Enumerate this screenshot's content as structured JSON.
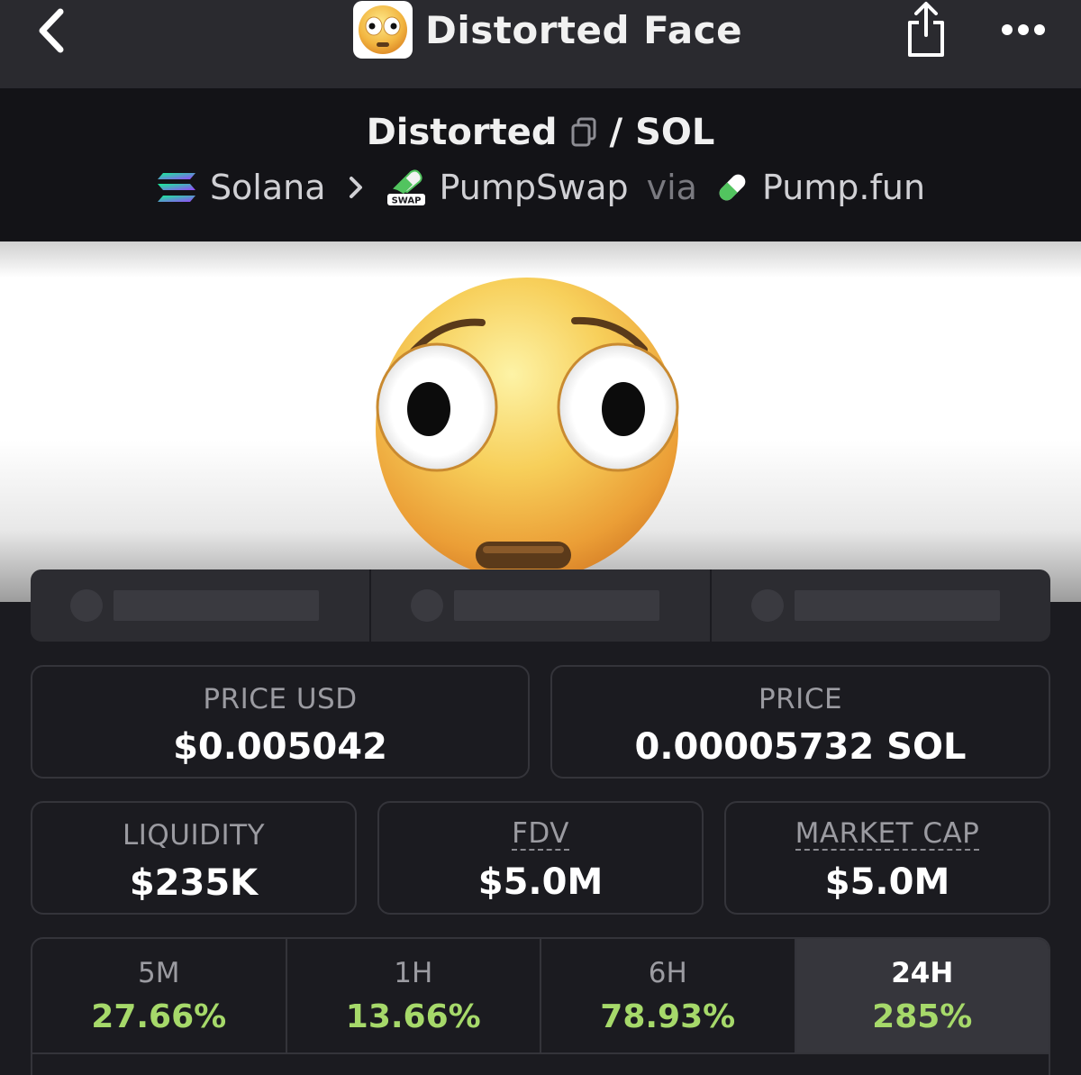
{
  "nav": {
    "title": "Distorted Face",
    "back_icon": "chevron-left-icon",
    "share_icon": "share-icon",
    "more_icon": "more-dots-icon"
  },
  "pair": {
    "base": "Distorted",
    "separator": "/",
    "quote": "SOL",
    "chain": "Solana",
    "dex": "PumpSwap",
    "via": "via",
    "launchpad": "Pump.fun",
    "dex_badge": "SWAP"
  },
  "stats": {
    "price_usd": {
      "label": "PRICE USD",
      "value": "$0.005042"
    },
    "price_native": {
      "label": "PRICE",
      "value": "0.00005732 SOL"
    },
    "liquidity": {
      "label": "LIQUIDITY",
      "value": "$235K"
    },
    "fdv": {
      "label": "FDV",
      "value": "$5.0M"
    },
    "market_cap": {
      "label": "MARKET CAP",
      "value": "$5.0M"
    }
  },
  "changes": [
    {
      "label": "5M",
      "value": "27.66%",
      "active": false
    },
    {
      "label": "1H",
      "value": "13.66%",
      "active": false
    },
    {
      "label": "6H",
      "value": "78.93%",
      "active": false
    },
    {
      "label": "24H",
      "value": "285%",
      "active": true
    }
  ],
  "colors": {
    "positive": "#a6d96a",
    "background": "#1b1b20",
    "nav_bg": "#2a2a2f",
    "header_bg": "#131317",
    "solana_gradient": [
      "#14f195",
      "#9945ff"
    ],
    "pill_green": "#52c45f"
  }
}
